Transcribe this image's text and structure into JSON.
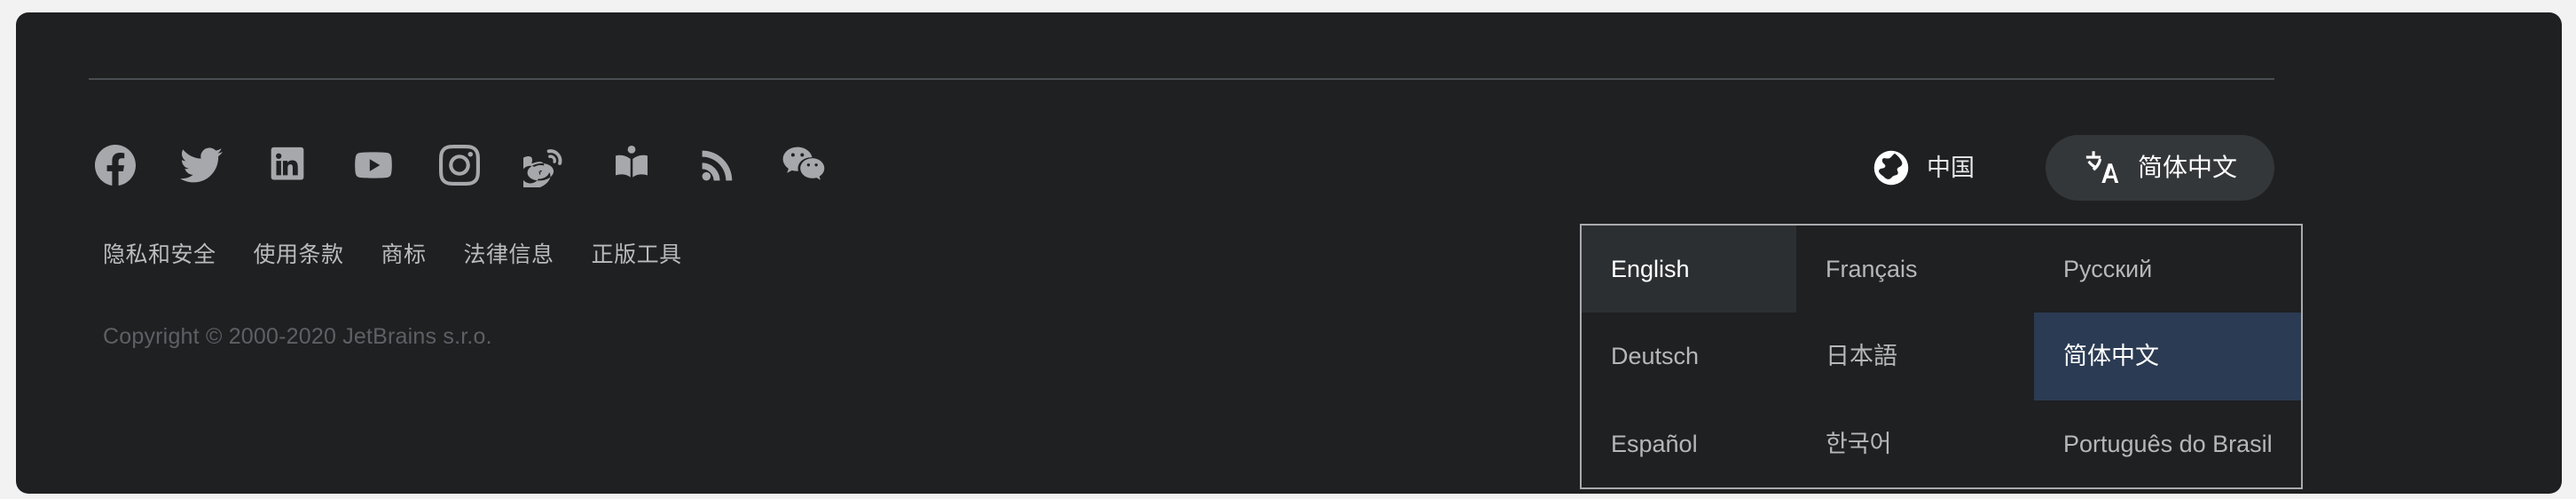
{
  "theme": {
    "page_background": "#f2f2f2",
    "panel_background": "#1e2022",
    "divider_color": "#4a4d51",
    "link_color": "#b9bbbe",
    "muted_text_color": "#5d6064",
    "icon_color": "#a6a8ab",
    "pill_background": "#34373a",
    "dropdown_border": "#a9abae",
    "dropdown_hover_background": "#2c2f32",
    "dropdown_selected_background": "#2b3b53",
    "selected_text_color": "#ffffff"
  },
  "social": {
    "items": [
      {
        "icon": "facebook-icon",
        "label": "Facebook"
      },
      {
        "icon": "twitter-icon",
        "label": "Twitter"
      },
      {
        "icon": "linkedin-icon",
        "label": "LinkedIn"
      },
      {
        "icon": "youtube-icon",
        "label": "YouTube"
      },
      {
        "icon": "instagram-icon",
        "label": "Instagram"
      },
      {
        "icon": "weibo-icon",
        "label": "Weibo"
      },
      {
        "icon": "blog-book-icon",
        "label": "Blog"
      },
      {
        "icon": "rss-icon",
        "label": "RSS"
      },
      {
        "icon": "wechat-icon",
        "label": "WeChat"
      }
    ]
  },
  "footer_links": [
    {
      "label": "隐私和安全"
    },
    {
      "label": "使用条款"
    },
    {
      "label": "商标"
    },
    {
      "label": "法律信息"
    },
    {
      "label": "正版工具"
    }
  ],
  "copyright": {
    "text": "Copyright © 2000-2020 JetBrains s.r.o."
  },
  "controls": {
    "region": {
      "icon": "globe-icon",
      "label": "中国"
    },
    "language_pill": {
      "icon": "translate-icon",
      "label": "简体中文"
    }
  },
  "language_dropdown": {
    "open": true,
    "options": [
      {
        "label": "English",
        "state": "hovered"
      },
      {
        "label": "Français",
        "state": "normal"
      },
      {
        "label": "Русский",
        "state": "normal"
      },
      {
        "label": "Deutsch",
        "state": "normal"
      },
      {
        "label": "日本語",
        "state": "normal"
      },
      {
        "label": "简体中文",
        "state": "selected"
      },
      {
        "label": "Español",
        "state": "normal"
      },
      {
        "label": "한국어",
        "state": "normal"
      },
      {
        "label": "Português do Brasil",
        "state": "normal"
      }
    ]
  }
}
